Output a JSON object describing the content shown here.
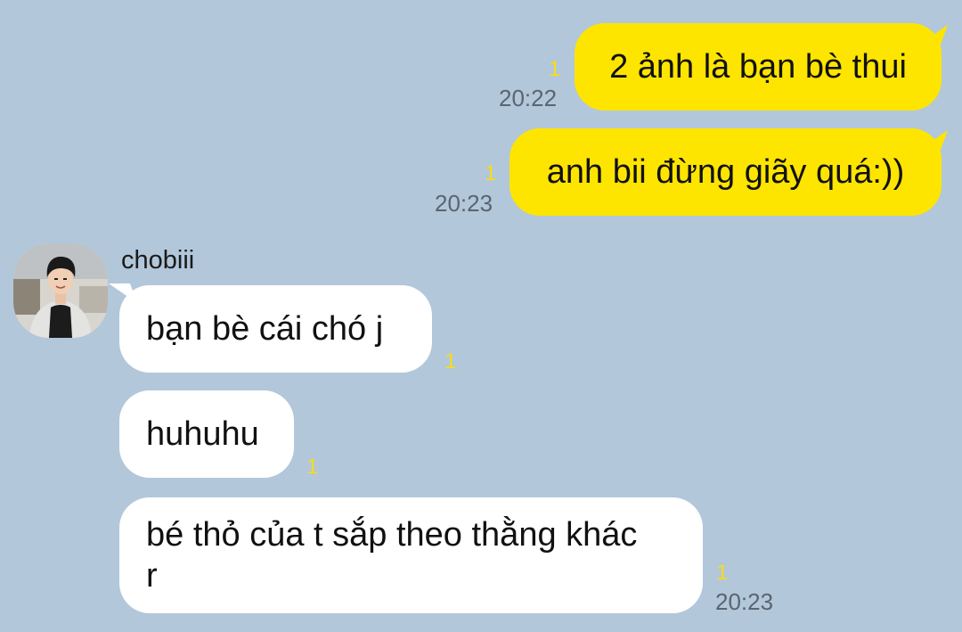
{
  "messages_out": [
    {
      "text": "2 ảnh là bạn bè thui",
      "unread": "1",
      "time": "20:22"
    },
    {
      "text": "anh bii đừng giãy quá:))",
      "unread": "1",
      "time": "20:23"
    }
  ],
  "sender": {
    "name": "chobiii",
    "avatar_icon": "profile-photo"
  },
  "messages_in": [
    {
      "text": "bạn bè cái chó j",
      "unread": "1"
    },
    {
      "text": "huhuhu",
      "unread": "1"
    },
    {
      "text_line1": "bé thỏ của t sắp theo thằng khác",
      "text_line2": "r",
      "unread": "1",
      "time": "20:23"
    }
  ],
  "colors": {
    "background": "#b2c7da",
    "outgoing_bubble": "#fee500",
    "incoming_bubble": "#ffffff",
    "unread_count": "#f6dc1a"
  }
}
